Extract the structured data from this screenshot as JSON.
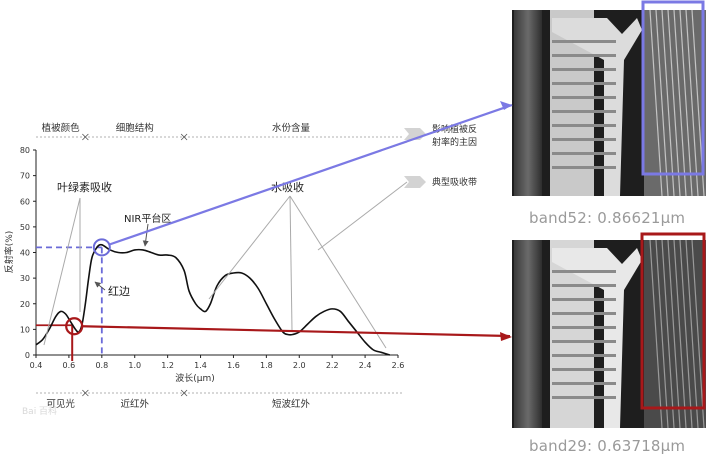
{
  "chart_data": {
    "type": "line",
    "ylabel": "反射率(%)",
    "xlabel": "波长(μm)",
    "xlim": [
      0.4,
      2.6
    ],
    "ylim": [
      0,
      80
    ],
    "xticks": [
      "0.4",
      "0.6",
      "0.8",
      "1.0",
      "1.2",
      "1.4",
      "1.6",
      "1.8",
      "2.0",
      "2.2",
      "2.4",
      "2.6"
    ],
    "yticks": [
      "0",
      "10",
      "20",
      "30",
      "40",
      "50",
      "60",
      "70",
      "80"
    ],
    "series": [
      {
        "x": [
          0.4,
          0.44,
          0.48,
          0.52,
          0.55,
          0.58,
          0.61,
          0.64,
          0.66,
          0.68,
          0.7,
          0.72,
          0.74,
          0.77,
          0.8,
          0.85,
          0.9,
          0.95,
          1.0,
          1.05,
          1.1,
          1.15,
          1.2,
          1.25,
          1.3,
          1.33,
          1.37,
          1.4,
          1.43,
          1.46,
          1.5,
          1.55,
          1.6,
          1.65,
          1.7,
          1.75,
          1.8,
          1.85,
          1.9,
          1.93,
          1.96,
          2.0,
          2.05,
          2.1,
          2.15,
          2.2,
          2.25,
          2.3,
          2.35,
          2.4,
          2.45,
          2.5,
          2.55
        ],
        "y": [
          4,
          6,
          10,
          15,
          17,
          16,
          13,
          10,
          9,
          12,
          20,
          30,
          38,
          42,
          43,
          41,
          40,
          40,
          41,
          41,
          40,
          39,
          39,
          38,
          33,
          25,
          20,
          18,
          17,
          20,
          27,
          31,
          32,
          32,
          30,
          26,
          20,
          14,
          9,
          8,
          8,
          9,
          12,
          15,
          17,
          18,
          17,
          13,
          9,
          5,
          2,
          1,
          0
        ]
      }
    ],
    "top_regions": [
      "植被颜色",
      "细胞结构",
      "水份含量"
    ],
    "bottom_regions": [
      "可见光",
      "近红外",
      "短波红外"
    ],
    "annotations": {
      "chlorophyll": "叶绿素吸收",
      "water": "水吸收",
      "nir_plateau": "NIR平台区",
      "red_edge": "红边"
    },
    "legend": [
      {
        "label": "影响植被反射率的主因"
      },
      {
        "label": "典型吸收带"
      }
    ],
    "highlights": [
      {
        "x": 0.8,
        "y": 42,
        "color": "#6b6bd8"
      },
      {
        "x": 0.62,
        "y": 12,
        "color": "#a8181a"
      }
    ]
  },
  "bands": [
    {
      "caption": "band52: 0.86621μm",
      "color": "#7b79e4"
    },
    {
      "caption": "band29: 0.63718μm",
      "color": "#a8181a"
    }
  ],
  "watermark": "Bai 百科"
}
